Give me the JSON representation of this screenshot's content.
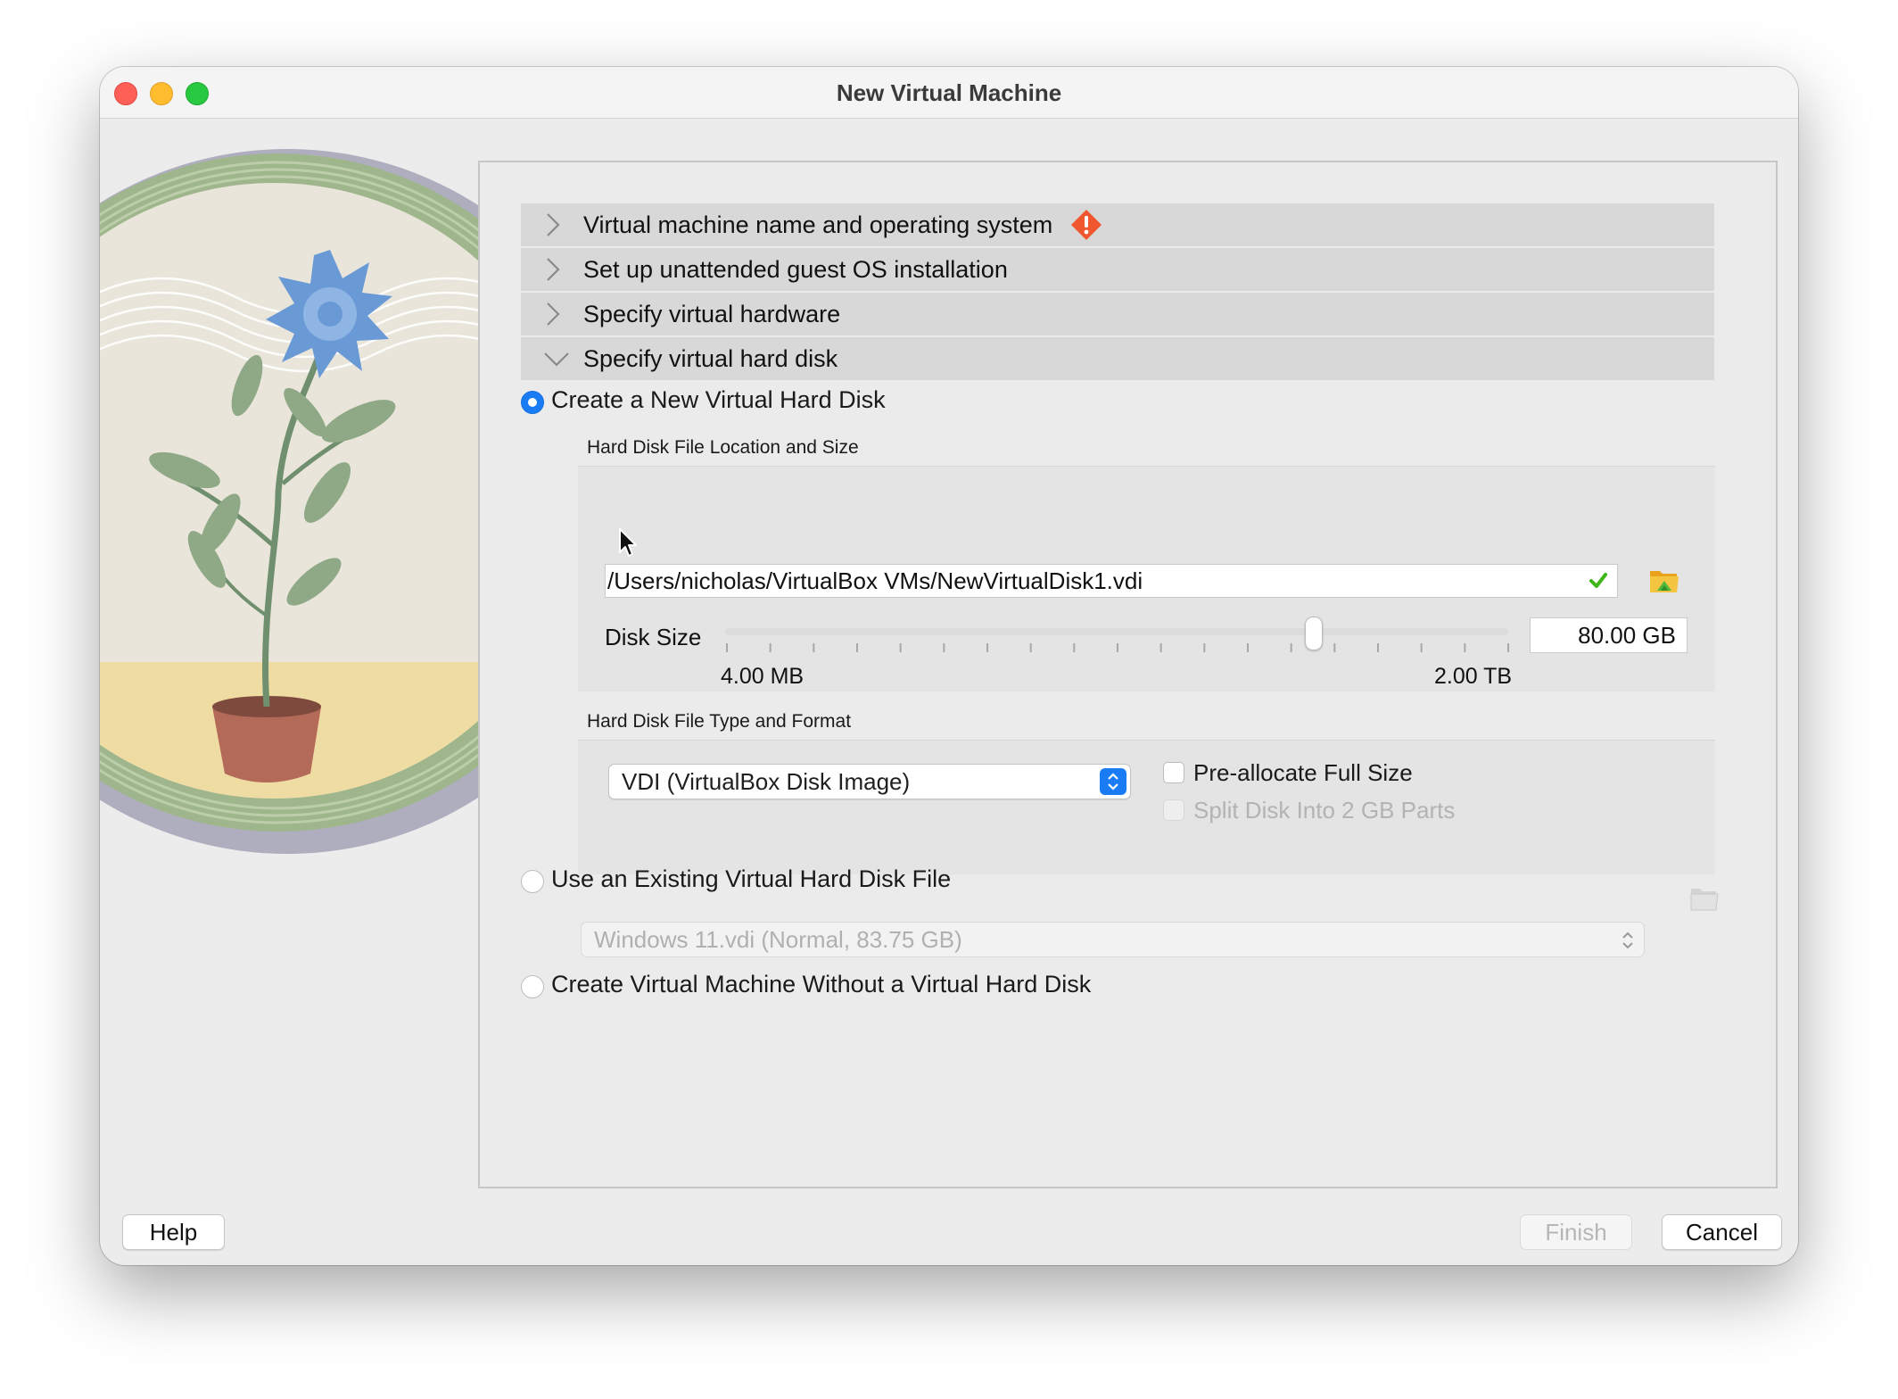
{
  "window": {
    "title": "New Virtual Machine"
  },
  "sections": [
    {
      "label": "Virtual machine name and operating system",
      "expanded": false,
      "has_warning": true
    },
    {
      "label": "Set up unattended guest OS installation",
      "expanded": false
    },
    {
      "label": "Specify virtual hardware",
      "expanded": false
    },
    {
      "label": "Specify virtual hard disk",
      "expanded": true
    }
  ],
  "hard_disk": {
    "create_new": {
      "label": "Create a New Virtual Hard Disk",
      "selected": true,
      "location_group_title": "Hard Disk File Location and Size",
      "path": "/Users/nicholas/VirtualBox VMs/NewVirtualDisk1.vdi",
      "disk_size_label": "Disk Size",
      "disk_size_value": "80.00 GB",
      "slider_min_label": "4.00 MB",
      "slider_max_label": "2.00 TB",
      "slider_position": 0.751,
      "type_group_title": "Hard Disk File Type and Format",
      "format_selected": "VDI (VirtualBox Disk Image)",
      "preallocate_label": "Pre-allocate Full Size",
      "preallocate_checked": false,
      "split_label": "Split Disk Into 2 GB Parts",
      "split_checked": false
    },
    "use_existing": {
      "label": "Use an Existing Virtual Hard Disk File",
      "selected": false,
      "selected_file": "Windows 11.vdi (Normal, 83.75 GB)"
    },
    "no_disk": {
      "label": "Create Virtual Machine Without a Virtual Hard Disk",
      "selected": false
    }
  },
  "buttons": {
    "help": "Help",
    "finish": "Finish",
    "cancel": "Cancel"
  },
  "colors": {
    "accent": "#1a7cf5",
    "warning": "#f0572e",
    "valid_check": "#3fb618"
  },
  "icons": [
    "chevron-right-icon",
    "chevron-down-icon",
    "warning-icon",
    "check-icon",
    "folder-open-icon",
    "mouse-cursor-icon"
  ]
}
